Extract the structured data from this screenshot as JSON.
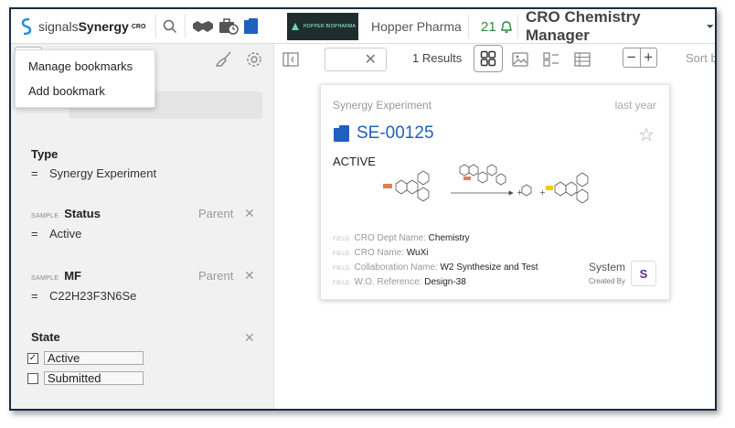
{
  "app": {
    "logo_text_light": "signals",
    "logo_text_bold": "Synergy",
    "logo_suffix": "CRO"
  },
  "org": {
    "logo_label": "HOPPER BIOPHARMA",
    "name": "Hopper Pharma"
  },
  "notifications": {
    "count": "21"
  },
  "role": {
    "label": "CRO Chemistry Manager"
  },
  "bookmarks_menu": {
    "items": [
      {
        "label": "Manage bookmarks"
      },
      {
        "label": "Add bookmark"
      }
    ]
  },
  "filters": {
    "type": {
      "label": "Type",
      "operator": "=",
      "value": "Synergy Experiment"
    },
    "status": {
      "prefix": "SAMPLE",
      "label": "Status",
      "parent": "Parent",
      "operator": "=",
      "value": "Active"
    },
    "mf": {
      "prefix": "SAMPLE",
      "label": "MF",
      "parent": "Parent",
      "operator": "=",
      "value": "C22H23F3N6Se"
    },
    "state": {
      "label": "State",
      "options": [
        {
          "label": "Active",
          "checked": true
        },
        {
          "label": "Submitted",
          "checked": false
        }
      ]
    }
  },
  "toolbar": {
    "results_text": "1 Results",
    "sort_label": "Sort b"
  },
  "card": {
    "type": "Synergy Experiment",
    "time": "last year",
    "id": "SE-00125",
    "status": "ACTIVE",
    "fields": [
      {
        "prefix": "FIELD",
        "label": "CRO Dept Name:",
        "value": "Chemistry"
      },
      {
        "prefix": "FIELD",
        "label": "CRO Name:",
        "value": "WuXi"
      },
      {
        "prefix": "FIELD",
        "label": "Collaboration Name:",
        "value": "W2 Synthesize and Test"
      },
      {
        "prefix": "FIELD",
        "label": "W.O. Reference:",
        "value": "Design-38"
      }
    ],
    "creator": "System",
    "created_by_label": "Created By",
    "avatar_initial": "S"
  },
  "colors": {
    "accent": "#1f5fbf",
    "notification": "#2e8b3a",
    "avatar": "#5b2c8f"
  }
}
